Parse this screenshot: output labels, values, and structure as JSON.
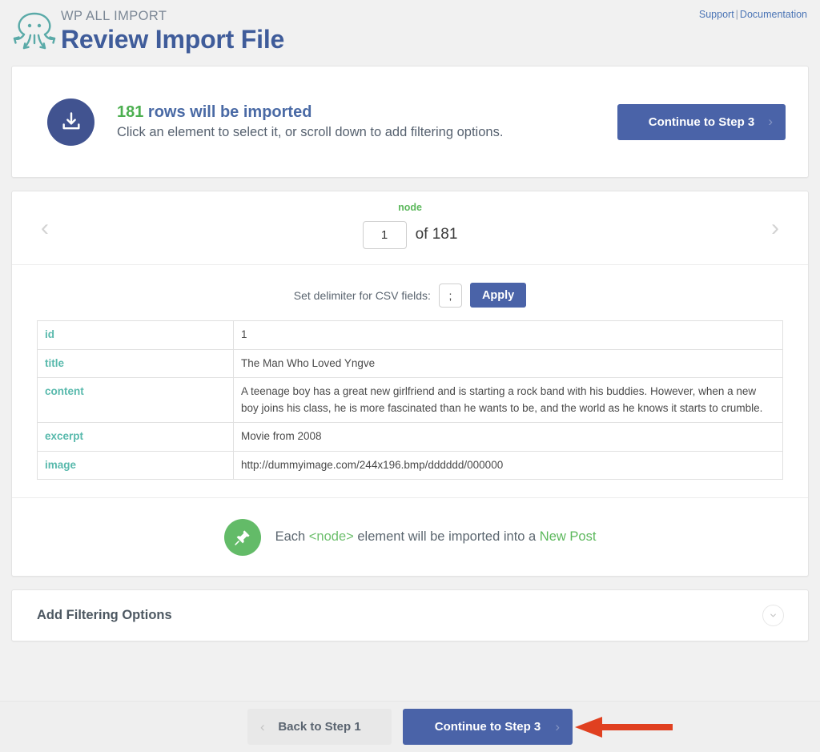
{
  "header": {
    "kicker": "WP ALL IMPORT",
    "title": "Review Import File",
    "logo_icon": "octopus-logo-icon",
    "links": {
      "support": "Support",
      "separator": "|",
      "documentation": "Documentation"
    }
  },
  "banner": {
    "icon": "import-download-icon",
    "count": "181",
    "line1_rest": " rows will be imported",
    "line2": "Click an element to select it, or scroll down to add filtering options.",
    "continue_label": "Continue to Step 3",
    "chevron": "›"
  },
  "pager": {
    "prev_icon": "‹",
    "next_icon": "›",
    "node_label": "node",
    "current_page": "1",
    "of_text": "of 181"
  },
  "delimiter": {
    "label": "Set delimiter for CSV fields:",
    "value": ";",
    "apply_label": "Apply"
  },
  "table": {
    "rows": [
      {
        "key": "id",
        "value": "1"
      },
      {
        "key": "title",
        "value": "The Man Who Loved Yngve"
      },
      {
        "key": "content",
        "value": "A teenage boy has a great new girlfriend and is starting a rock band with his buddies. However, when a new boy joins his class, he is more fascinated than he wants to be, and the world as he knows it starts to crumble."
      },
      {
        "key": "excerpt",
        "value": "Movie from 2008"
      },
      {
        "key": "image",
        "value": "http://dummyimage.com/244x196.bmp/dddddd/000000"
      }
    ]
  },
  "import_note": {
    "icon": "pushpin-icon",
    "prefix": "Each ",
    "node_tag": "<node>",
    "middle": " element will be imported into a ",
    "target": "New Post"
  },
  "filtering": {
    "title": "Add Filtering Options",
    "collapse_icon": "chevron-down-icon"
  },
  "footer": {
    "back_label": "Back to Step 1",
    "back_chevron": "‹",
    "continue_label": "Continue to Step 3",
    "continue_chevron": "›"
  },
  "annotation": {
    "arrow_icon": "red-left-arrow-annotation",
    "color": "#e04020"
  },
  "colors": {
    "accent_blue": "#4a63a8",
    "title_blue": "#3f5c9a",
    "green": "#5cb85c",
    "teal": "#58b9ac",
    "page_bg": "#f1f1f1"
  }
}
